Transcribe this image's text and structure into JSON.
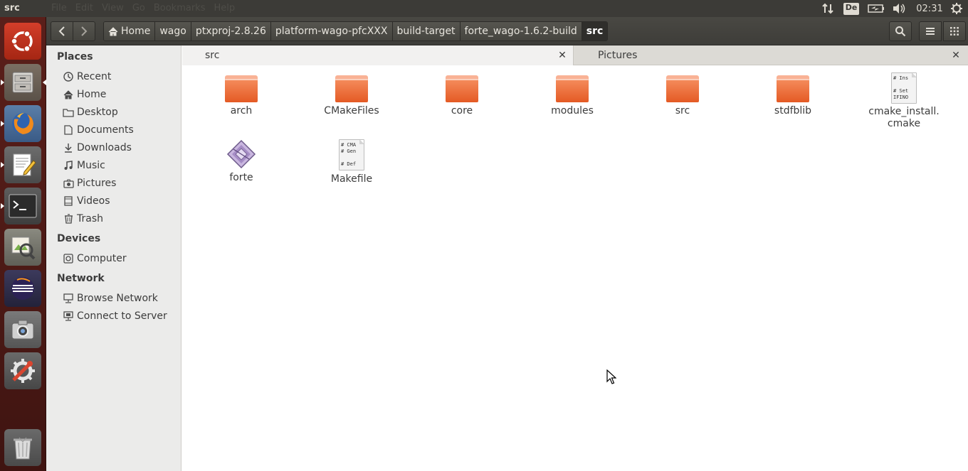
{
  "top_panel": {
    "window_title": "src",
    "ghost_menu": [
      "File",
      "Edit",
      "View",
      "Go",
      "Bookmarks",
      "Help"
    ],
    "keyboard_layout": "De",
    "clock": "02:31"
  },
  "launcher": {
    "items": [
      {
        "name": "ubuntu-dash"
      },
      {
        "name": "files"
      },
      {
        "name": "firefox"
      },
      {
        "name": "text-editor"
      },
      {
        "name": "terminal"
      },
      {
        "name": "image-viewer"
      },
      {
        "name": "eclipse"
      },
      {
        "name": "camera"
      },
      {
        "name": "system-settings"
      },
      {
        "name": "trash"
      }
    ]
  },
  "toolbar": {
    "breadcrumbs": [
      {
        "label": "Home"
      },
      {
        "label": "wago"
      },
      {
        "label": "ptxproj-2.8.26"
      },
      {
        "label": "platform-wago-pfcXXX"
      },
      {
        "label": "build-target"
      },
      {
        "label": "forte_wago-1.6.2-build"
      },
      {
        "label": "src"
      }
    ]
  },
  "sidebar": {
    "places_heading": "Places",
    "places": [
      {
        "label": "Recent",
        "icon": "clock-icon"
      },
      {
        "label": "Home",
        "icon": "home-icon"
      },
      {
        "label": "Desktop",
        "icon": "folder-icon"
      },
      {
        "label": "Documents",
        "icon": "document-icon"
      },
      {
        "label": "Downloads",
        "icon": "download-icon"
      },
      {
        "label": "Music",
        "icon": "music-icon"
      },
      {
        "label": "Pictures",
        "icon": "camera-icon"
      },
      {
        "label": "Videos",
        "icon": "film-icon"
      },
      {
        "label": "Trash",
        "icon": "trash-icon"
      }
    ],
    "devices_heading": "Devices",
    "devices": [
      {
        "label": "Computer",
        "icon": "drive-icon"
      }
    ],
    "network_heading": "Network",
    "network": [
      {
        "label": "Browse Network",
        "icon": "network-icon"
      },
      {
        "label": "Connect to Server",
        "icon": "server-icon"
      }
    ]
  },
  "tabs": [
    {
      "label": "src",
      "active": true
    },
    {
      "label": "Pictures",
      "active": false
    }
  ],
  "files": [
    {
      "label": "arch",
      "type": "folder"
    },
    {
      "label": "CMakeFiles",
      "type": "folder"
    },
    {
      "label": "core",
      "type": "folder"
    },
    {
      "label": "modules",
      "type": "folder"
    },
    {
      "label": "src",
      "type": "folder"
    },
    {
      "label": "stdfblib",
      "type": "folder"
    },
    {
      "label": "cmake_install.\ncmake",
      "type": "text",
      "preview": "# Ins\n\n# Set\nIFINO"
    },
    {
      "label": "forte",
      "type": "executable"
    },
    {
      "label": "Makefile",
      "type": "text",
      "preview": "# CMA\n# Gen\n\n# Def"
    }
  ]
}
